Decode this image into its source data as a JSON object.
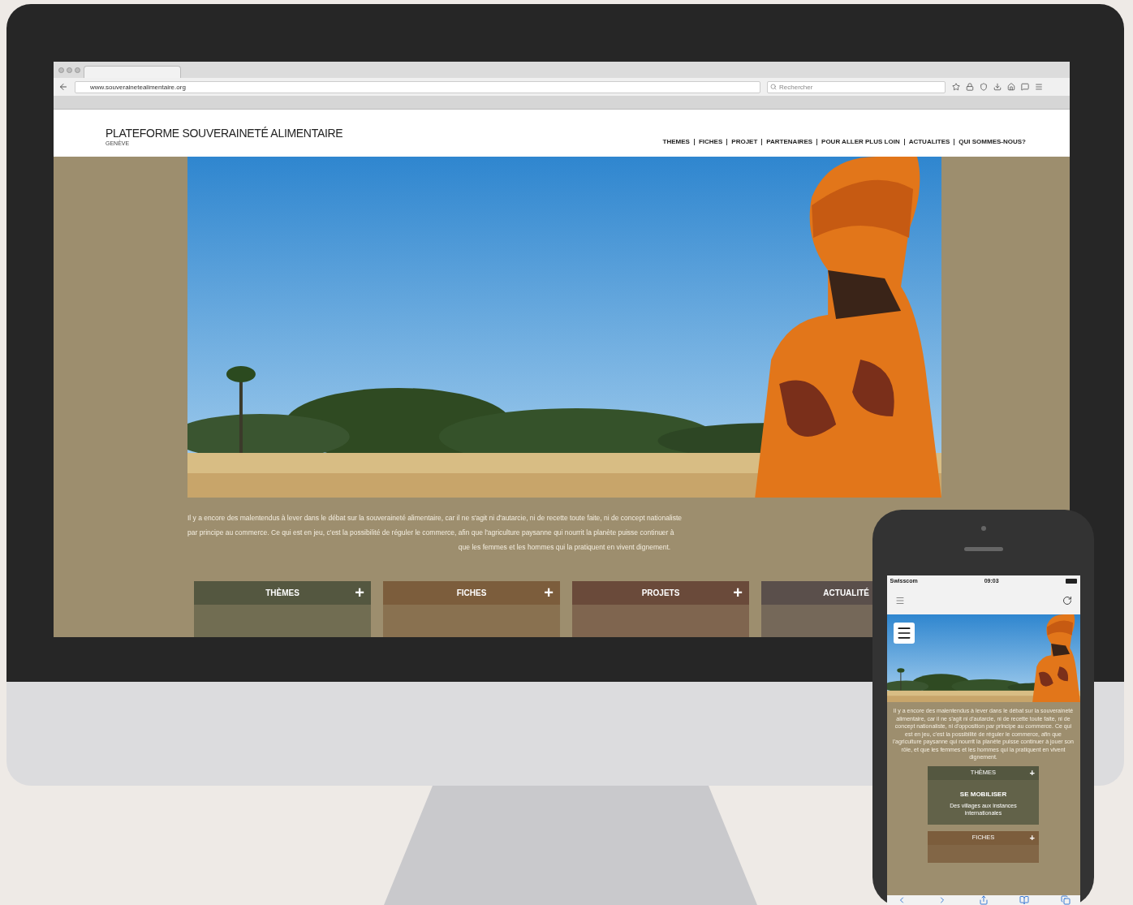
{
  "browser": {
    "url": "www.souverainetealimentaire.org",
    "search": {
      "placeholder": "Rechercher"
    }
  },
  "site": {
    "title": "PLATEFORME SOUVERAINETÉ ALIMENTAIRE",
    "subtitle": "GENÈVE",
    "nav": [
      "THEMES",
      "FICHES",
      "PROJET",
      "PARTENAIRES",
      "POUR ALLER PLUS LOIN",
      "ACTUALITES",
      "QUI SOMMES-NOUS?"
    ],
    "hero": {
      "kind": "picture"
    },
    "intro_lines": [
      "Il y a encore des malentendus à lever dans le débat sur la souveraineté alimentaire, car il ne s'agit ni d'autarcie, ni de recette toute faite, ni de concept nationaliste",
      "par principe au commerce. Ce qui est en jeu, c'est la possibilité de réguler le commerce, afin que l'agriculture paysanne qui nourrit la planète puisse continuer à",
      "que les femmes et les hommes qui la pratiquent en vivent dignement."
    ],
    "cards": [
      {
        "title": "THÈMES",
        "color": "#545740",
        "expand": "+"
      },
      {
        "title": "FICHES",
        "color": "#7c5d3c",
        "expand": "+"
      },
      {
        "title": "PROJETS",
        "color": "#6a4a3a",
        "expand": "+"
      },
      {
        "title": "ACTUALITÉ",
        "color": "#5a4f4b"
      }
    ]
  },
  "phone": {
    "carrier": "Swisscom",
    "time": "09:03",
    "intro": "Il y a encore des malentendus à lever dans le débat sur la souveraineté alimentaire, car il ne s'agit ni d'autarcie, ni de recette toute faite, ni de concept nationaliste, ni d'opposition par principe au commerce. Ce qui est en jeu, c'est la possibilité de réguler le commerce, afin que l'agriculture paysanne qui nourrit la planète puisse continuer à jouer son rôle, et que les femmes et les hommes qui la pratiquent en vivent dignement.",
    "cards": [
      {
        "title": "THÈMES",
        "color": "#545740",
        "expand": "+",
        "heading": "SE MOBILISER",
        "text": "Des villages aux instances internationales"
      },
      {
        "title": "FICHES",
        "color": "#7c5d3c",
        "expand": "+"
      }
    ]
  }
}
